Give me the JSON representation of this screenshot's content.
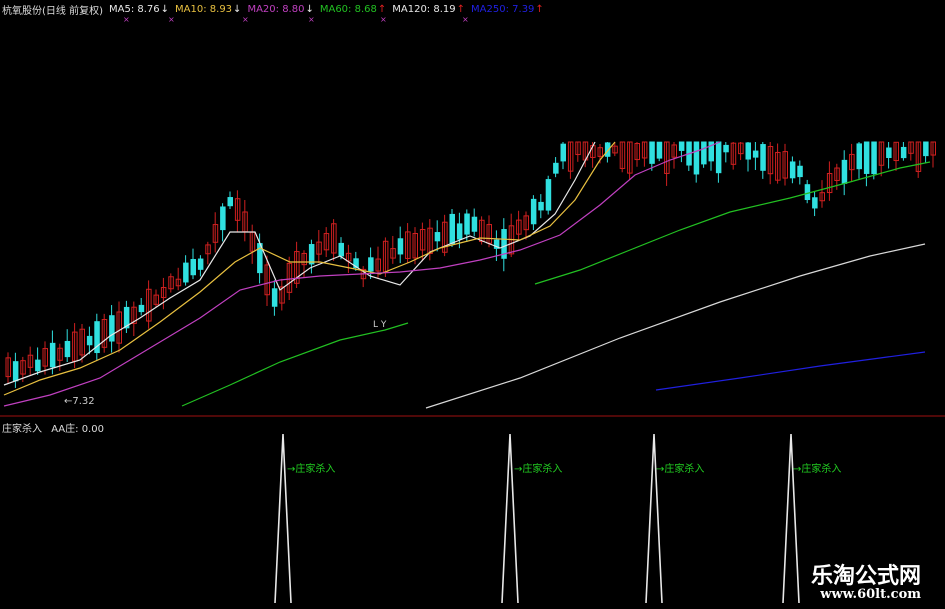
{
  "header": {
    "stock_name": "杭氧股份(日线 前复权)",
    "ma": [
      {
        "label": "MA5:",
        "value": "8.76",
        "dir": "↓",
        "color": "#e8e8e8",
        "arrow_color": "#e8e8e8"
      },
      {
        "label": "MA10:",
        "value": "8.93",
        "dir": "↓",
        "color": "#e8c040",
        "arrow_color": "#e8e8e8"
      },
      {
        "label": "MA20:",
        "value": "8.80",
        "dir": "↓",
        "color": "#c040c0",
        "arrow_color": "#e8e8e8"
      },
      {
        "label": "MA60:",
        "value": "8.68",
        "dir": "↑",
        "color": "#22c022",
        "arrow_color": "#e02020"
      },
      {
        "label": "MA120:",
        "value": "8.19",
        "dir": "↑",
        "color": "#e8e8e8",
        "arrow_color": "#e02020"
      },
      {
        "label": "MA250:",
        "value": "7.39",
        "dir": "↑",
        "color": "#2020e0",
        "arrow_color": "#e02020"
      }
    ]
  },
  "price_panel": {
    "low_label": "←7.32",
    "mark_label": "L Y"
  },
  "indicator_panel": {
    "title": "庄家杀入",
    "value_label": "AA庄: 0.00",
    "signal_label": "→庄家杀入",
    "signals_count": 4
  },
  "watermark": {
    "line1": "乐淘公式网",
    "line2": "www.60lt.com"
  },
  "colors": {
    "background": "#000000",
    "up": "#d02020",
    "down": "#30e0e0",
    "divider": "#a01010",
    "ma5": "#e8e8e8",
    "ma10": "#e8c040",
    "ma20": "#c040c0",
    "ma60": "#22c022",
    "ma120": "#d8d8d8",
    "ma250": "#2020e0",
    "signal": "#e8e8e8",
    "signal_label": "#22d022"
  }
}
